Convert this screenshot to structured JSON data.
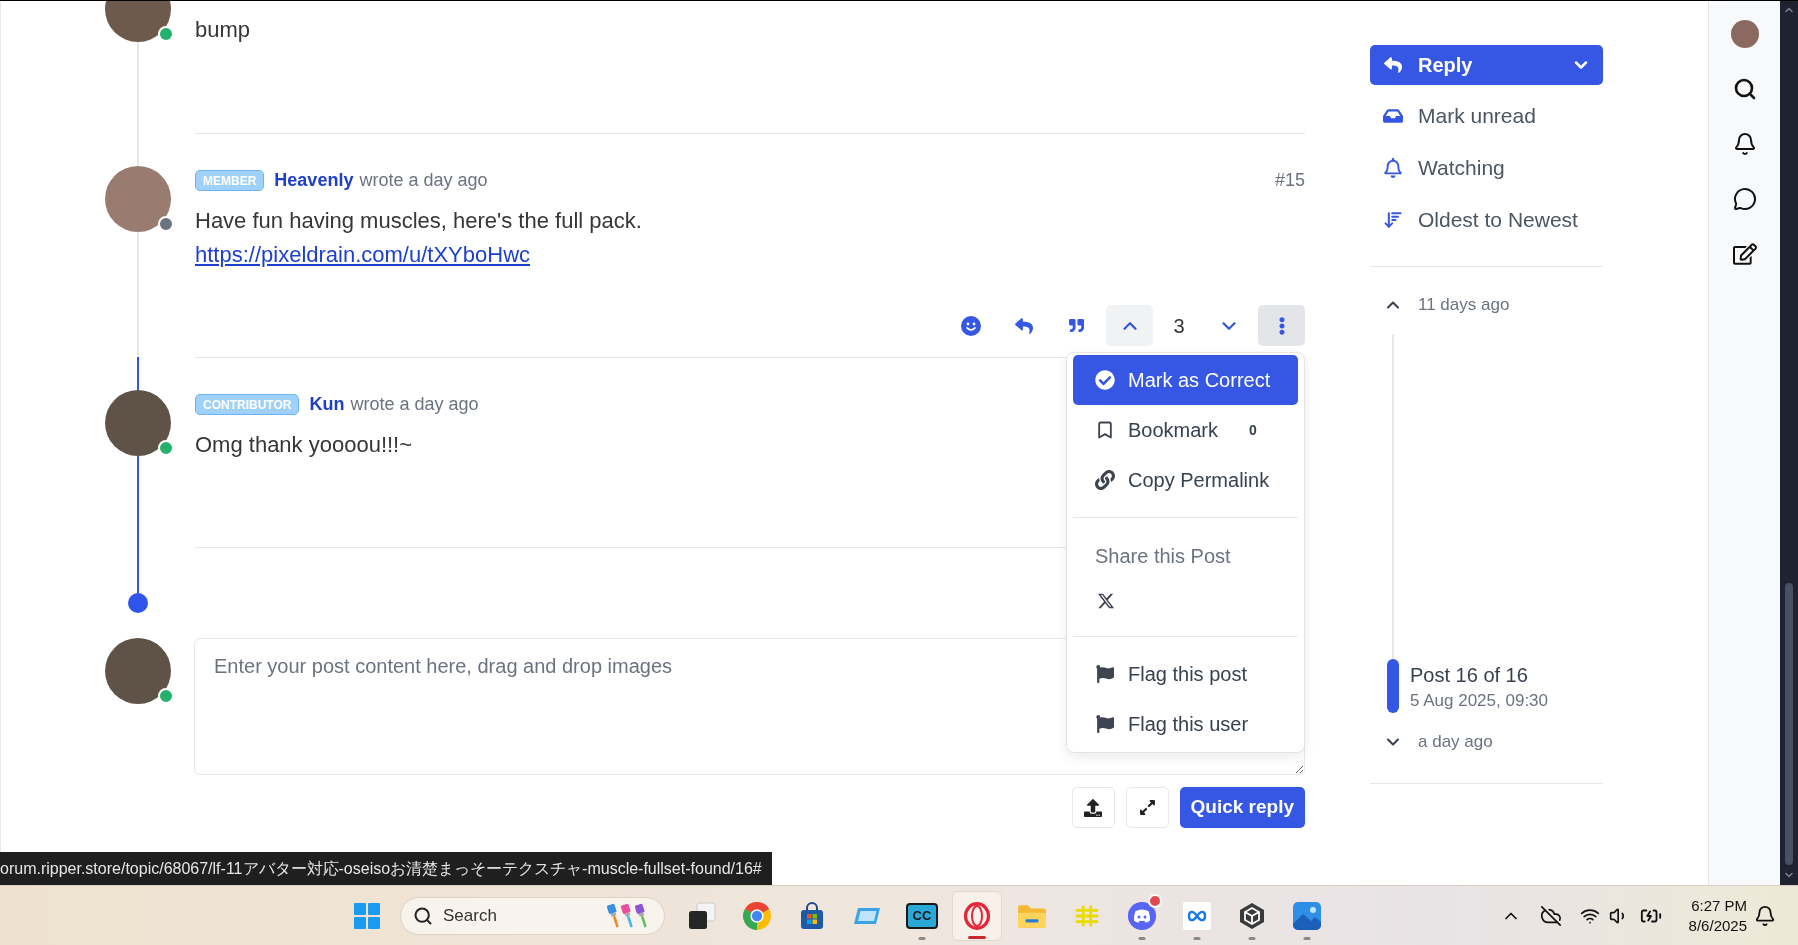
{
  "posts": [
    {
      "online": true,
      "highlighted": false,
      "body": "bump"
    },
    {
      "online": false,
      "highlighted": false,
      "badge": "MEMBER",
      "author": "Heavenly",
      "meta": "wrote a day ago",
      "index": "#15",
      "body": "Have fun having muscles, here's the full pack.",
      "link": "https://pixeldrain.com/u/tXYboHwc",
      "actions": {
        "upvoted": true,
        "votes": "3",
        "menu": {
          "open": true,
          "sections": [
            {
              "items": [
                {
                  "label": "Mark as Correct",
                  "highlighted": true
                },
                {
                  "label": "Bookmark",
                  "highlighted": false,
                  "count": "0"
                },
                {
                  "label": "Copy Permalink",
                  "highlighted": false
                }
              ]
            },
            {
              "heading": "Share this Post"
            },
            {
              "items": [
                {
                  "label": "Flag this post",
                  "highlighted": false
                },
                {
                  "label": "Flag this user",
                  "highlighted": false
                }
              ]
            }
          ]
        }
      }
    },
    {
      "online": true,
      "highlighted": true,
      "badge": "CONTRIBUTOR",
      "author": "Kun",
      "meta": "wrote a day ago",
      "body": "Omg thank yoooou!!!~"
    }
  ],
  "composer": {
    "online": true,
    "placeholder": "Enter your post content here, drag and drop images",
    "submit": "Quick reply"
  },
  "topic_tools": {
    "reply": "Reply",
    "items": [
      "Mark unread",
      "Watching",
      "Oldest to Newest"
    ]
  },
  "navigator": {
    "start": "11 days ago",
    "position": "Post 16 of 16",
    "date": "5 Aug 2025, 09:30",
    "end": "a day ago",
    "level": 1
  },
  "status_url": "orum.ripper.store/topic/68067/lf-11アバター対応-oseisoお清楚まっそーテクスチャ-muscle-fullset-found/16#",
  "taskbar": {
    "search": "Search",
    "apps": [
      {
        "running": false,
        "active": false,
        "alert": false
      },
      {
        "running": false,
        "active": false,
        "alert": false
      },
      {
        "running": false,
        "active": false,
        "alert": false
      },
      {
        "running": false,
        "active": false,
        "alert": false
      },
      {
        "running": true,
        "active": false,
        "alert": false,
        "text": "CC"
      },
      {
        "running": true,
        "active": true,
        "alert": false
      },
      {
        "running": false,
        "active": false,
        "alert": false
      },
      {
        "running": false,
        "active": false,
        "alert": false
      },
      {
        "running": true,
        "active": false,
        "alert": true
      },
      {
        "running": true,
        "active": false,
        "alert": false
      },
      {
        "running": true,
        "active": false,
        "alert": false
      },
      {
        "running": true,
        "active": false,
        "alert": false
      }
    ],
    "time": "6:27 PM",
    "date": "8/6/2025"
  }
}
